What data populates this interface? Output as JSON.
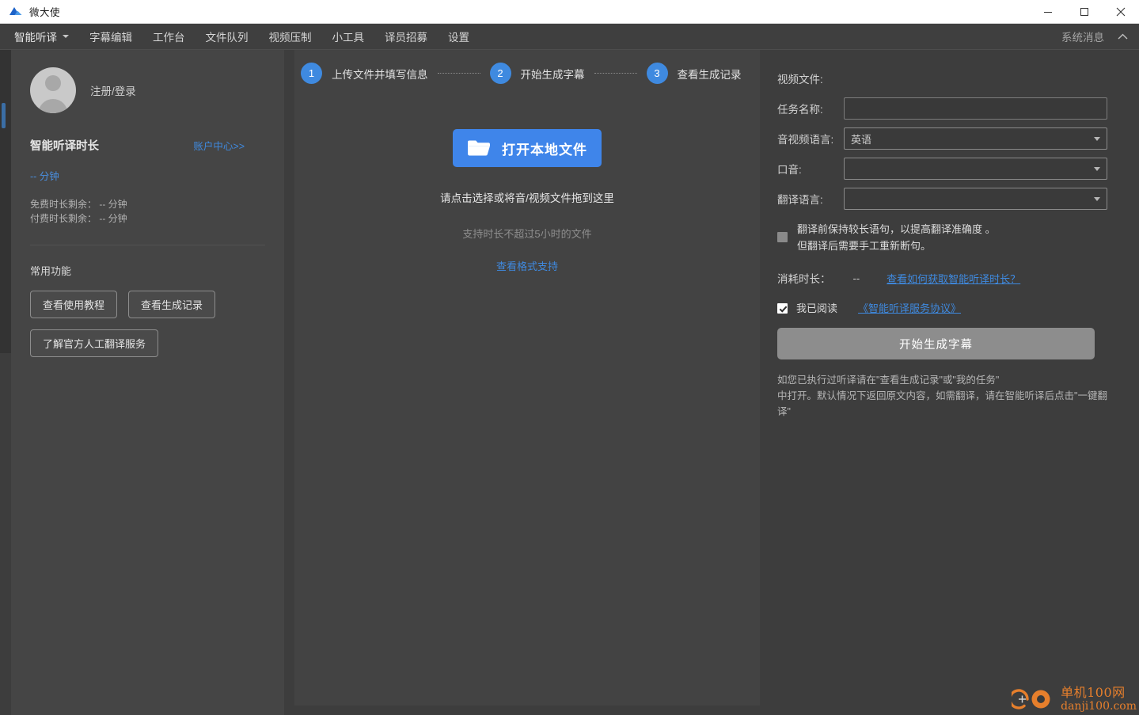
{
  "window": {
    "app_icon": "app-logo-icon",
    "title": "微大使",
    "minimize": "minimize-icon",
    "maximize": "maximize-icon",
    "close": "close-icon"
  },
  "menubar": {
    "items": [
      {
        "label": "智能听译",
        "has_caret": true
      },
      {
        "label": "字幕编辑",
        "has_caret": false
      },
      {
        "label": "工作台",
        "has_caret": false
      },
      {
        "label": "文件队列",
        "has_caret": false
      },
      {
        "label": "视频压制",
        "has_caret": false
      },
      {
        "label": "小工具",
        "has_caret": false
      },
      {
        "label": "译员招募",
        "has_caret": false
      },
      {
        "label": "设置",
        "has_caret": false
      }
    ],
    "system_message": "系统消息",
    "collapse_icon": "chevron-up-icon"
  },
  "sidebar": {
    "profile_name": "注册/登录",
    "quota_title": "智能听译时长",
    "account_center": "账户中心>>",
    "quota_value": "-- 分钟",
    "free_remaining": "免费时长剩余： -- 分钟",
    "paid_remaining": "付费时长剩余： -- 分钟",
    "functions_title": "常用功能",
    "buttons": [
      "查看使用教程",
      "查看生成记录",
      "了解官方人工翻译服务"
    ]
  },
  "main": {
    "steps": [
      {
        "num": "1",
        "label": "上传文件并填写信息"
      },
      {
        "num": "2",
        "label": "开始生成字幕"
      },
      {
        "num": "3",
        "label": "查看生成记录"
      }
    ],
    "open_file_button": "打开本地文件",
    "folder_icon": "folder-open-icon",
    "drop_hint": "请点击选择或将音/视频文件拖到这里",
    "drop_sub": "支持时长不超过5小时的文件",
    "format_link": "查看格式支持"
  },
  "form": {
    "video_file_label": "视频文件:",
    "video_file_value": "",
    "task_name_label": "任务名称:",
    "task_name_value": "",
    "task_name_placeholder": "",
    "av_language_label": "音视频语言:",
    "av_language_value": "英语",
    "accent_label": "口音:",
    "accent_value": "",
    "translate_language_label": "翻译语言:",
    "translate_language_value": "",
    "long_sentence_line1": "翻译前保持较长语句，以提高翻译准确度 。",
    "long_sentence_line2": "但翻译后需要手工重新断句。",
    "long_sentence_checked": false,
    "consume_label": "消耗时长：",
    "consume_value": "--",
    "consume_link": "查看如何获取智能听译时长？",
    "agree_checked": true,
    "agree_text": "我已阅读",
    "agreement_link": "《智能听译服务协议》",
    "submit_label": "开始生成字幕",
    "footnote_line1": "如您已执行过听译请在\"查看生成记录\"或\"我的任务\"",
    "footnote_line2": "中打开。默认情况下返回原文内容，如需翻译，请在智能听译后点击\"一键翻译\""
  },
  "watermark": {
    "line1": "单机100网",
    "line2": "danji100.com",
    "color": "#f0832c"
  },
  "colors": {
    "accent_blue": "#3f8ae0",
    "button_blue": "#3f85ea",
    "panel_bg": "#434343",
    "sidebar_bg": "#454545",
    "right_bg": "#3d3d3d"
  }
}
